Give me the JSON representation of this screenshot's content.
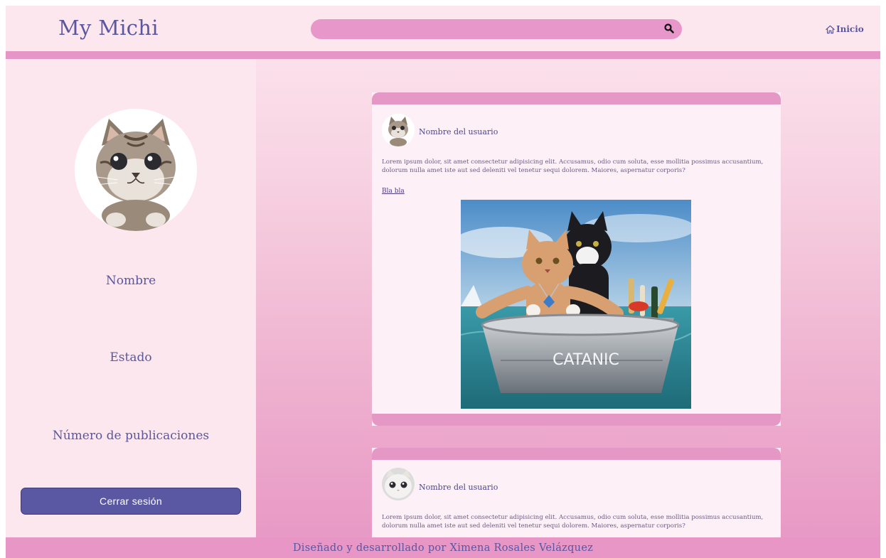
{
  "header": {
    "logo": "My Michi",
    "search": {
      "value": "",
      "placeholder": ""
    },
    "home_label": "Inicio"
  },
  "sidebar": {
    "name_label": "Nombre",
    "status_label": "Estado",
    "posts_count_label": "Número de publicaciones",
    "logout_label": "Cerrar sesión"
  },
  "posts": [
    {
      "username": "Nombre del usuario",
      "body": "Lorem ipsum dolor, sit amet consectetur adipisicing elit. Accusamus, odio cum soluta, esse mollitia possimus accusantium, dolorum nulla amet iste aut sed deleniti vel tenetur sequi dolorem. Maiores, aspernatur corporis?",
      "link": "Bla bla",
      "image_caption": "CATANIC"
    },
    {
      "username": "Nombre del usuario",
      "body": "Lorem ipsum dolor, sit amet consectetur adipisicing elit. Accusamus, odio cum soluta, esse mollitia possimus accusantium, dolorum nulla amet iste aut sed deleniti vel tenetur sequi dolorem. Maiores, aspernatur corporis?"
    }
  ],
  "footer": {
    "credit": "Diseñado y desarrollado por Ximena Rosales Velázquez"
  },
  "colors": {
    "accent_pink": "#e596c6",
    "header_bg": "#fde7ee",
    "brand_purple": "#5a56a0",
    "button_bg": "#5a58a3"
  },
  "icons": {
    "search": "magnifier-icon",
    "home": "home-icon"
  }
}
